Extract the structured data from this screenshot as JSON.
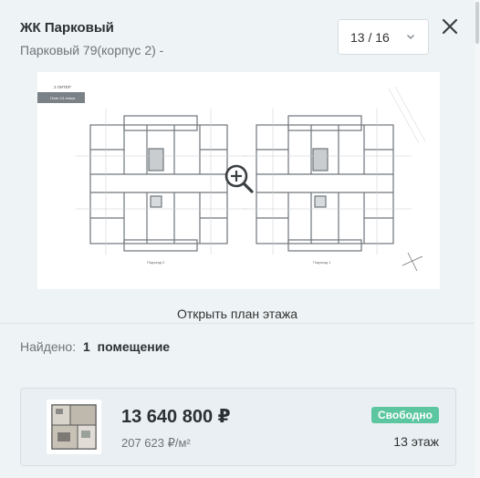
{
  "header": {
    "title": "ЖК Парковый",
    "subtitle": "Парковый 79(корпус 2) -"
  },
  "pager": {
    "label": "13 / 16"
  },
  "plan": {
    "open_label": "Открыть план этажа",
    "tag_top": "2 ЛИТЕР",
    "tag_box": "План 13 этажа",
    "section_left": "Подъезд 2",
    "section_right": "Подъезд 1"
  },
  "results": {
    "prefix": "Найдено:",
    "count": "1",
    "unit": "помещение"
  },
  "listing": {
    "price": "13 640 800 ₽",
    "price_per_m2": "207 623 ₽/м²",
    "status": "Свободно",
    "floor": "13 этаж"
  },
  "colors": {
    "accent": "#5cc6a0",
    "background": "#eef3f5"
  }
}
